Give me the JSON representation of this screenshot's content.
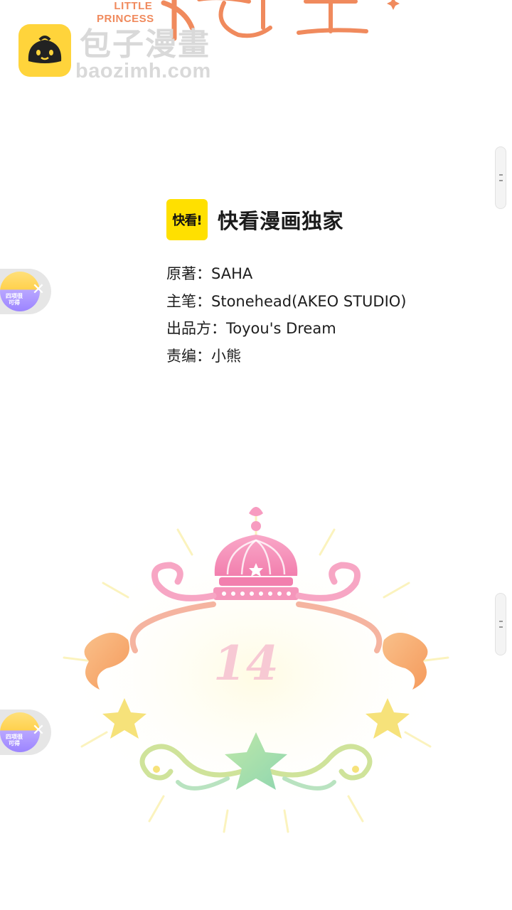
{
  "top_title": {
    "subtitle_line1": "LITTLE",
    "subtitle_line2": "PRINCESS",
    "color": "#f08a5d"
  },
  "watermark": {
    "site_name": "包子漫畫",
    "url": "baozimh.com",
    "logo_icon": "bun-face-icon",
    "logo_color": "#ffd43b"
  },
  "brand": {
    "logo_text": "快看!",
    "exclusive_text": "快看漫画独家",
    "logo_color": "#ffe000"
  },
  "credits": [
    {
      "role": "原著：",
      "name": "SAHA"
    },
    {
      "role": "主笔：",
      "name": "Stonehead(AKEO STUDIO)"
    },
    {
      "role": "出品方：",
      "name": "Toyou's Dream"
    },
    {
      "role": "责编：",
      "name": "小熊"
    }
  ],
  "chapter": {
    "number": "14",
    "crown_color": "#f79cc0",
    "star_color": "#f6e27a",
    "center_star_color": "#a8e6a3"
  },
  "ad_chips": [
    {
      "thumb_text": "四项很\n可得",
      "close_icon": "close-icon"
    },
    {
      "thumb_text": "四项很\n可得",
      "close_icon": "close-icon"
    }
  ]
}
